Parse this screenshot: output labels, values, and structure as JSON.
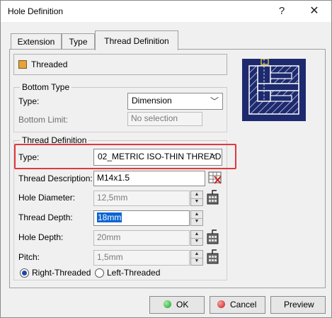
{
  "window": {
    "title": "Hole Definition"
  },
  "titlebar": {
    "help_label": "?",
    "close_label": "✕"
  },
  "tabs": [
    {
      "label": "Extension",
      "active": false
    },
    {
      "label": "Type",
      "active": false
    },
    {
      "label": "Thread Definition",
      "active": true
    }
  ],
  "threaded": {
    "label": "Threaded",
    "checked": true
  },
  "bottom_type": {
    "legend": "Bottom Type",
    "type_label": "Type:",
    "type_value": "Dimension",
    "limit_label": "Bottom Limit:",
    "limit_value": "No selection"
  },
  "thread_definition": {
    "legend": "Thread Definition",
    "type_label": "Type:",
    "type_value": "02_METRIC ISO-THIN THREAD",
    "description_label": "Thread Description:",
    "description_value": "M14x1.5",
    "hole_diameter_label": "Hole Diameter:",
    "hole_diameter_value": "12,5mm",
    "thread_depth_label": "Thread Depth:",
    "thread_depth_value": "18mm",
    "hole_depth_label": "Hole Depth:",
    "hole_depth_value": "20mm",
    "pitch_label": "Pitch:",
    "pitch_value": "1,5mm"
  },
  "handedness": {
    "right_label": "Right-Threaded",
    "left_label": "Left-Threaded",
    "selected": "right"
  },
  "buttons": {
    "ok": "OK",
    "cancel": "Cancel",
    "preview": "Preview"
  },
  "colors": {
    "highlight": "#e0393e",
    "preview_bg": "#1d2a6e",
    "selection": "#0a64d2"
  }
}
